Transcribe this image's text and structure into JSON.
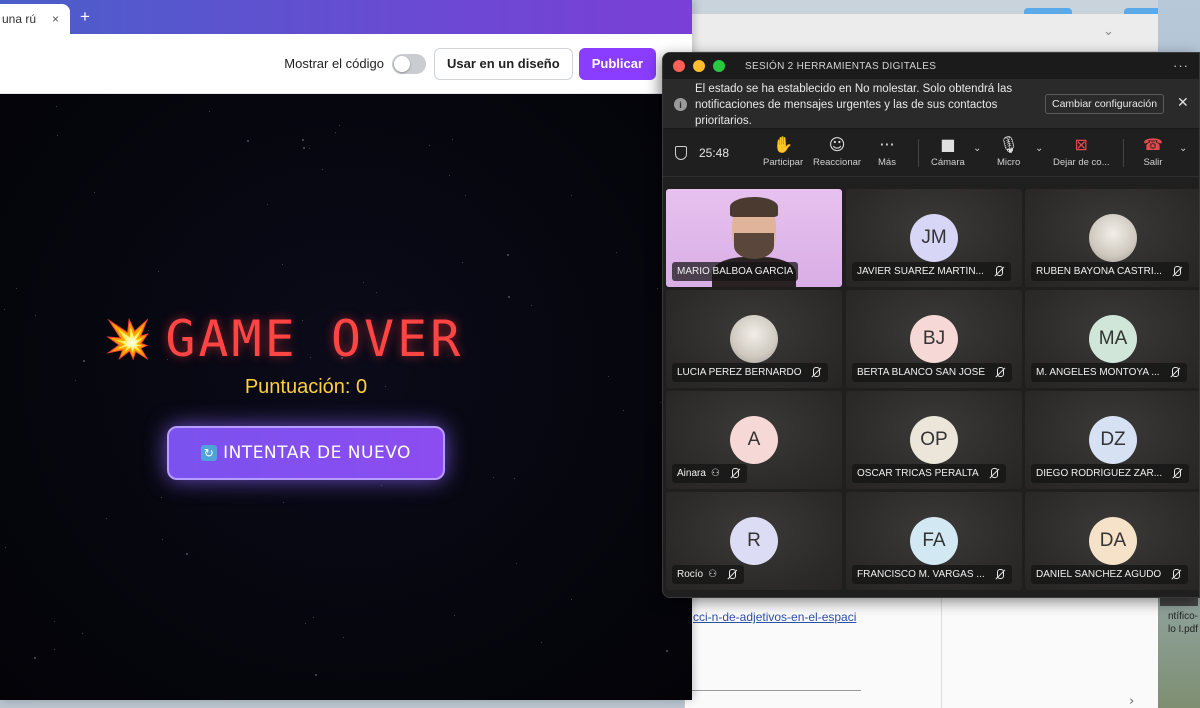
{
  "browser": {
    "tab_title": "una rú",
    "tab_close": "×",
    "new_tab": "+"
  },
  "editor": {
    "show_code_label": "Mostrar el código",
    "use_in_design_label": "Usar en un diseño",
    "publish_label": "Publicar",
    "close": "×"
  },
  "game": {
    "title": "GAME OVER",
    "explosion": "💥",
    "score_text": "Puntuación: 0",
    "retry_icon": "↻",
    "retry_label": "INTENTAR DE NUEVO"
  },
  "background": {
    "link_text": "cci-n-de-adjetivos-en-el-espaci",
    "pdf_label_line1": "ntífico-",
    "pdf_label_line2": "lo I.pdf",
    "chevron": "⌄",
    "arrow": "›"
  },
  "meeting": {
    "title": "SESIÓN 2 HERRAMIENTAS DIGITALES",
    "more": "···",
    "notice_text": "El estado se ha establecido en No molestar. Solo obtendrá las notificaciones de mensajes urgentes y las de sus contactos prioritarios.",
    "notice_info": "i",
    "change_settings_label": "Cambiar configuración",
    "notice_close": "✕",
    "timer": "25:48",
    "controls": {
      "raise_hand": {
        "icon": "✋",
        "label": "Participar"
      },
      "react": {
        "icon": "☺",
        "label": "Reaccionar"
      },
      "more": {
        "icon": "···",
        "label": "Más"
      },
      "camera": {
        "icon": "■",
        "label": "Cámara"
      },
      "mic": {
        "icon": "🎙",
        "label": "Micro"
      },
      "share": {
        "icon": "⊠",
        "label": "Dejar de co..."
      },
      "leave": {
        "icon": "☎",
        "label": "Salir"
      }
    },
    "participants": [
      {
        "name": "MARIO BALBOA GARCÍA",
        "initials": "",
        "avatar_color": "",
        "video": true,
        "muted": false,
        "guest": false
      },
      {
        "name": "JAVIER SUÁREZ MARTÍN...",
        "initials": "JM",
        "avatar_color": "#d7d6f6",
        "video": false,
        "muted": true,
        "guest": false
      },
      {
        "name": "RUBEN BAYONA CASTRI...",
        "initials": "",
        "avatar_color": "#f1efea",
        "video": false,
        "muted": true,
        "guest": false,
        "photo": true
      },
      {
        "name": "LUCIA PEREZ BERNARDO",
        "initials": "",
        "avatar_color": "#b8c0c6",
        "video": false,
        "muted": true,
        "guest": false,
        "photo": true
      },
      {
        "name": "BERTA BLANCO SAN JOSÉ",
        "initials": "BJ",
        "avatar_color": "#f6d8d6",
        "video": false,
        "muted": true,
        "guest": false
      },
      {
        "name": "M. ANGELES MONTOYA ...",
        "initials": "MA",
        "avatar_color": "#cfe6d8",
        "video": false,
        "muted": true,
        "guest": false
      },
      {
        "name": "Ainara",
        "initials": "A",
        "avatar_color": "#f6d8d6",
        "video": false,
        "muted": true,
        "guest": true
      },
      {
        "name": "OSCAR TRICAS PERALTA",
        "initials": "OP",
        "avatar_color": "#ece6da",
        "video": false,
        "muted": true,
        "guest": false
      },
      {
        "name": "DIEGO RODRÍGUEZ ZÁR...",
        "initials": "DZ",
        "avatar_color": "#d6e2f4",
        "video": false,
        "muted": true,
        "guest": false
      },
      {
        "name": "Rocío",
        "initials": "R",
        "avatar_color": "#dcdcf4",
        "video": false,
        "muted": true,
        "guest": true
      },
      {
        "name": "FRANCISCO M. VARGAS ...",
        "initials": "FA",
        "avatar_color": "#d2e8f2",
        "video": false,
        "muted": true,
        "guest": false
      },
      {
        "name": "DANIEL SANCHEZ AGUDO",
        "initials": "DA",
        "avatar_color": "#f6e2c8",
        "video": false,
        "muted": true,
        "guest": false
      }
    ]
  },
  "colors": {
    "publish_purple": "#8b3dff",
    "game_over_red": "#ff4444",
    "score_yellow": "#ffd23a",
    "retry_purple": "#7b52ef",
    "leave_red": "#e5484d",
    "meeting_bg": "#1f1f1f"
  }
}
